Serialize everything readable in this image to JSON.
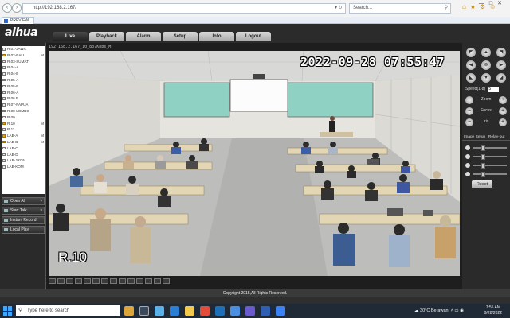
{
  "browser": {
    "url": "http://192.168.2.167/",
    "search_placeholder": "Search...",
    "tab_title": "PREVIEW"
  },
  "app": {
    "logo": "alhua",
    "tabs": [
      "Live",
      "Playback",
      "Alarm",
      "Setup",
      "Info",
      "Logout"
    ],
    "active_tab": "Live"
  },
  "channels": [
    {
      "label": "R.01-JAWA",
      "on": false,
      "mark": ""
    },
    {
      "label": "R.02-BALI",
      "on": true,
      "mark": "M"
    },
    {
      "label": "R.03-SUMAT",
      "on": false,
      "mark": ""
    },
    {
      "label": "R.04-A",
      "on": false,
      "mark": ""
    },
    {
      "label": "R.04-B",
      "on": false,
      "mark": ""
    },
    {
      "label": "R.05-A",
      "on": false,
      "mark": ""
    },
    {
      "label": "R.05-B",
      "on": false,
      "mark": ""
    },
    {
      "label": "R.06-A",
      "on": false,
      "mark": ""
    },
    {
      "label": "R.06.B",
      "on": false,
      "mark": ""
    },
    {
      "label": "R.07-PAPUA",
      "on": false,
      "mark": ""
    },
    {
      "label": "R.08-LOMBO",
      "on": false,
      "mark": ""
    },
    {
      "label": "R.09",
      "on": false,
      "mark": ""
    },
    {
      "label": "R.10",
      "on": true,
      "mark": "M"
    },
    {
      "label": "R.11",
      "on": false,
      "mark": ""
    },
    {
      "label": "LAB-A",
      "on": true,
      "mark": "M"
    },
    {
      "label": "LAB-B",
      "on": true,
      "mark": "M"
    },
    {
      "label": "LAB-C",
      "on": false,
      "mark": ""
    },
    {
      "label": "LAB-D",
      "on": false,
      "mark": ""
    },
    {
      "label": "LAB-JRGN",
      "on": false,
      "mark": ""
    },
    {
      "label": "LAB-KOM",
      "on": false,
      "mark": ""
    }
  ],
  "panel_buttons": [
    {
      "label": "Open All",
      "arrow": "▾"
    },
    {
      "label": "Start Talk",
      "arrow": "▾"
    },
    {
      "label": "Instant Record",
      "arrow": ""
    },
    {
      "label": "Local Play",
      "arrow": ""
    }
  ],
  "video": {
    "info": "192.168.2.167_10_837Kbps_M",
    "timestamp": "2022-09-28  07:55:47",
    "camera_name": "R.10"
  },
  "ptz": {
    "speed_label": "Speed(1-8)",
    "speed_value": "5",
    "zoom_label": "Zoom",
    "focus_label": "Focus",
    "iris_label": "Iris"
  },
  "image_setup": {
    "tab1": "Image Setup",
    "tab2": "Relay-out",
    "sliders": [
      0.3,
      0.3,
      0.3,
      0.3
    ],
    "reset_label": "Reset"
  },
  "copyright": "Copyright 2015,All Rights Reserved.",
  "taskbar": {
    "search_placeholder": "Type here to search",
    "weather_temp": "30°C",
    "weather_desc": "Berawan",
    "time": "7:55 AM",
    "date": "9/28/2022"
  }
}
